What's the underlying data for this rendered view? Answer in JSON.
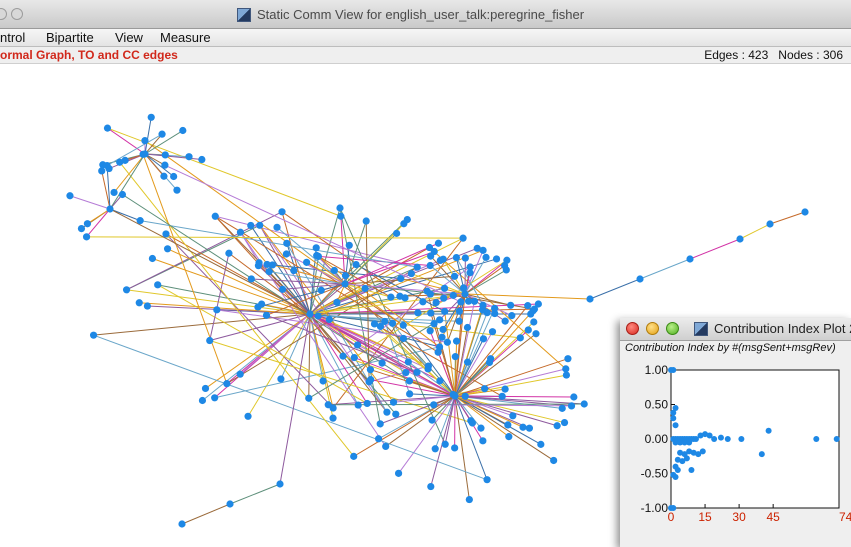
{
  "window": {
    "title": "Static Comm View for english_user_talk:peregrine_fisher"
  },
  "menu": [
    "ntrol",
    "Bipartite",
    "View",
    "Measure"
  ],
  "status": {
    "mode": "ormal Graph,  TO and CC edges",
    "edges": "Edges : 423",
    "nodes": "Nodes : 306"
  },
  "graph": {
    "node_color": "#1e88e5"
  },
  "plot_window": {
    "title": "Contribution Index Plot 2",
    "subtitle": "Contribution Index by #(msgSent+msgRev)"
  },
  "chart_data": {
    "type": "scatter",
    "title": "",
    "xlabel": "",
    "ylabel": "",
    "xlim": [
      0,
      74
    ],
    "ylim": [
      -1.0,
      1.0
    ],
    "x_ticks": [
      "0",
      "15",
      "30",
      "45",
      "74"
    ],
    "y_ticks": [
      "1.00",
      "0.50",
      "0.00",
      "-0.50",
      "-1.00"
    ],
    "points": [
      [
        0,
        1.0
      ],
      [
        1,
        1.0
      ],
      [
        0,
        -1.0
      ],
      [
        1,
        -1.0
      ],
      [
        1,
        0.38
      ],
      [
        2,
        0.45
      ],
      [
        1,
        0.3
      ],
      [
        2,
        0.2
      ],
      [
        1,
        0.0
      ],
      [
        2,
        0.0
      ],
      [
        3,
        0.0
      ],
      [
        4,
        0.0
      ],
      [
        5,
        0.0
      ],
      [
        6,
        0.0
      ],
      [
        7,
        0.0
      ],
      [
        8,
        0.0
      ],
      [
        9,
        0.0
      ],
      [
        10,
        0.0
      ],
      [
        11,
        0.0
      ],
      [
        2,
        -0.05
      ],
      [
        4,
        -0.05
      ],
      [
        6,
        -0.05
      ],
      [
        8,
        -0.05
      ],
      [
        13,
        0.05
      ],
      [
        15,
        0.07
      ],
      [
        17,
        0.05
      ],
      [
        19,
        0.0
      ],
      [
        22,
        0.02
      ],
      [
        25,
        0.0
      ],
      [
        4,
        -0.2
      ],
      [
        6,
        -0.22
      ],
      [
        8,
        -0.18
      ],
      [
        10,
        -0.2
      ],
      [
        12,
        -0.22
      ],
      [
        14,
        -0.18
      ],
      [
        3,
        -0.3
      ],
      [
        5,
        -0.32
      ],
      [
        7,
        -0.28
      ],
      [
        2,
        -0.4
      ],
      [
        3,
        -0.45
      ],
      [
        1,
        -0.52
      ],
      [
        2,
        -0.55
      ],
      [
        9,
        -0.45
      ],
      [
        31,
        0.0
      ],
      [
        40,
        -0.22
      ],
      [
        43,
        0.12
      ],
      [
        64,
        0.0
      ],
      [
        73,
        0.0
      ]
    ],
    "tick_label_color": "#cc2200",
    "point_color": "#1e88e5"
  }
}
